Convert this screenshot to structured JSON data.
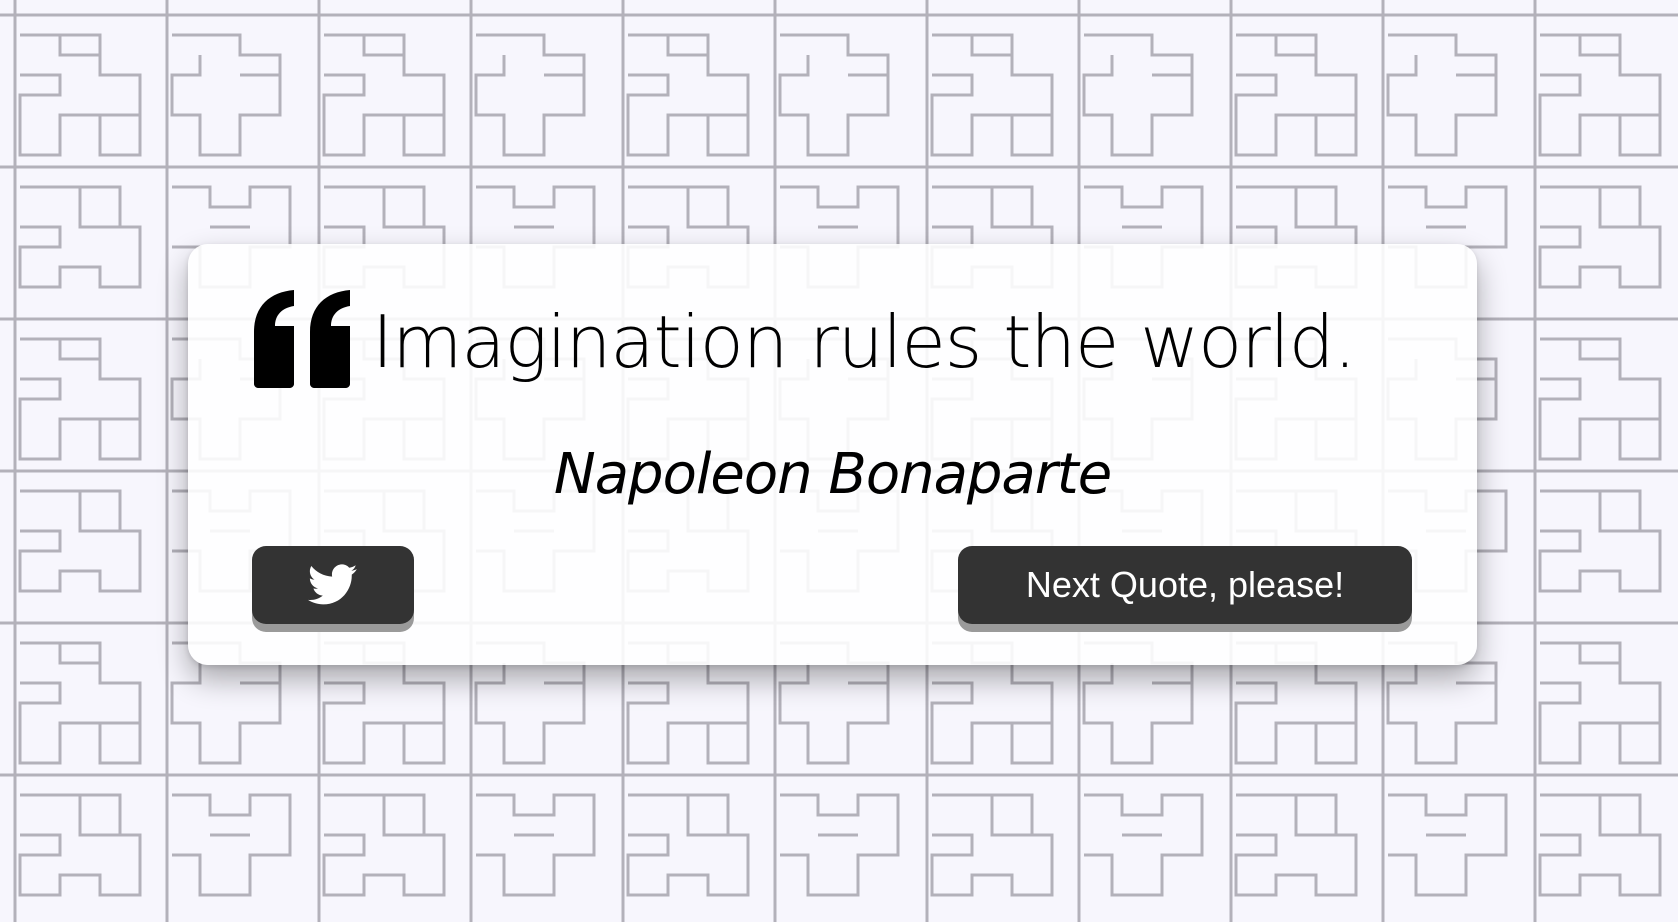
{
  "quote": {
    "text": "Imagination rules the world.",
    "author": "Napoleon Bonaparte"
  },
  "buttons": {
    "tweet_icon": "twitter-icon",
    "next_label": "Next Quote, please!"
  },
  "colors": {
    "background": "#f7f6fd",
    "pattern_line": "#b3b1ba",
    "card": "#ffffff",
    "button": "#333333",
    "button_shadow": "#9a9a9a",
    "text": "#000000"
  }
}
